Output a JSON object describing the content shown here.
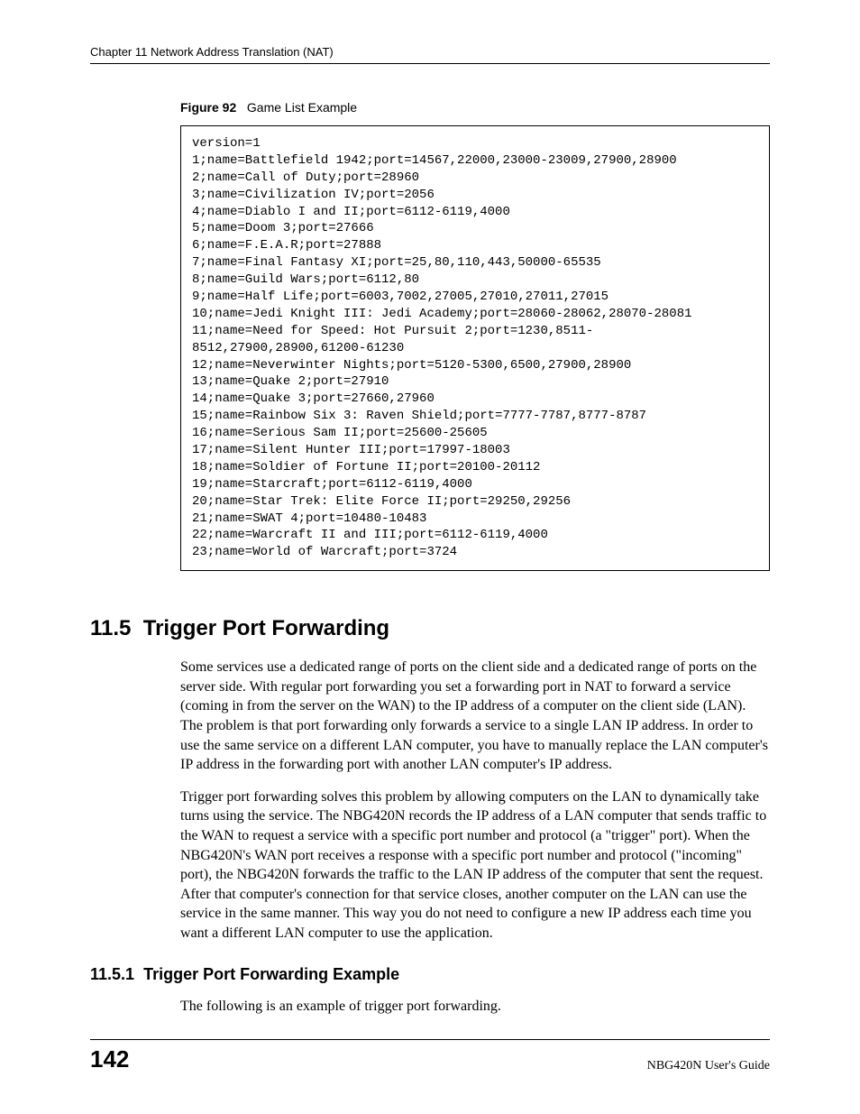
{
  "header": {
    "running_head": "Chapter 11 Network Address Translation (NAT)"
  },
  "figure": {
    "label": "Figure 92",
    "title": "Game List Example",
    "code_lines": [
      "version=1",
      "1;name=Battlefield 1942;port=14567,22000,23000-23009,27900,28900",
      "2;name=Call of Duty;port=28960",
      "3;name=Civilization IV;port=2056",
      "4;name=Diablo I and II;port=6112-6119,4000",
      "5;name=Doom 3;port=27666",
      "6;name=F.E.A.R;port=27888",
      "7;name=Final Fantasy XI;port=25,80,110,443,50000-65535",
      "8;name=Guild Wars;port=6112,80",
      "9;name=Half Life;port=6003,7002,27005,27010,27011,27015",
      "10;name=Jedi Knight III: Jedi Academy;port=28060-28062,28070-28081",
      "11;name=Need for Speed: Hot Pursuit 2;port=1230,8511-8512,27900,28900,61200-61230",
      "12;name=Neverwinter Nights;port=5120-5300,6500,27900,28900",
      "13;name=Quake 2;port=27910",
      "14;name=Quake 3;port=27660,27960",
      "15;name=Rainbow Six 3: Raven Shield;port=7777-7787,8777-8787",
      "16;name=Serious Sam II;port=25600-25605",
      "17;name=Silent Hunter III;port=17997-18003",
      "18;name=Soldier of Fortune II;port=20100-20112",
      "19;name=Starcraft;port=6112-6119,4000",
      "20;name=Star Trek: Elite Force II;port=29250,29256",
      "21;name=SWAT 4;port=10480-10483",
      "22;name=Warcraft II and III;port=6112-6119,4000",
      "23;name=World of Warcraft;port=3724"
    ]
  },
  "section": {
    "number": "11.5",
    "title": "Trigger Port Forwarding",
    "p1": "Some services use a dedicated range of ports on the client side and a dedicated range of ports on the server side. With regular port forwarding you set a forwarding port in NAT to forward a service (coming in from the server on the WAN) to the IP address of a computer on the client side (LAN). The problem is that port forwarding only forwards a service to a single LAN IP address. In order to use the same service on a different LAN computer, you have to manually replace the LAN computer's IP address in the forwarding port with another LAN computer's IP address.",
    "p2": "Trigger port forwarding solves this problem by allowing computers on the LAN to dynamically take turns using the service. The NBG420N records the IP address of a LAN computer that sends traffic to the WAN to request a service with a specific port number and protocol (a \"trigger\" port). When the NBG420N's WAN port receives a response with a specific port number and protocol (\"incoming\" port), the NBG420N forwards the traffic to the LAN IP address of the computer that sent the request. After that computer's connection for that service closes, another computer on the LAN can use the service in the same manner. This way you do not need to configure a new IP address each time you want a different LAN computer to use the application."
  },
  "subsection": {
    "number": "11.5.1",
    "title": "Trigger Port Forwarding Example",
    "p1": "The following is an example of trigger port forwarding."
  },
  "footer": {
    "page_number": "142",
    "guide": "NBG420N User's Guide"
  }
}
